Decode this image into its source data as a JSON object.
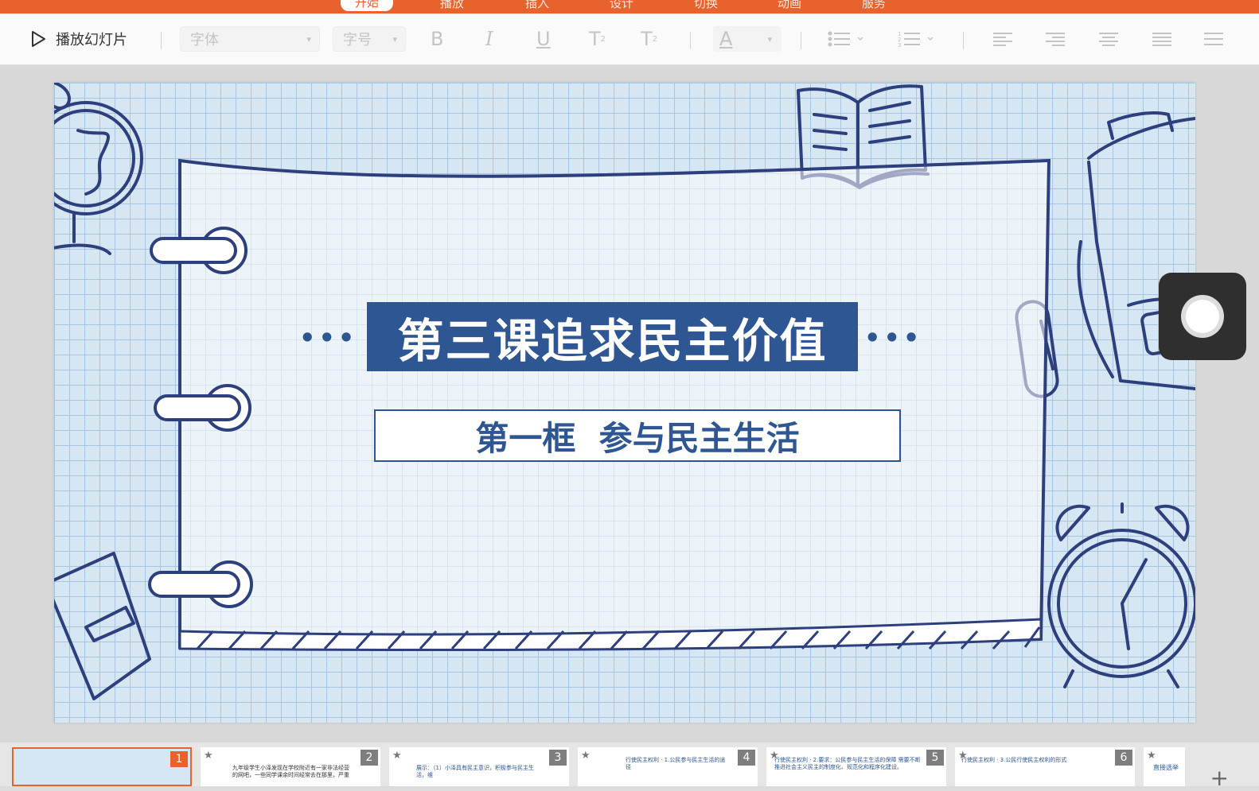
{
  "tabs": {
    "items": [
      "开始",
      "播放",
      "插入",
      "设计",
      "切换",
      "动画",
      "服务"
    ]
  },
  "toolbar": {
    "play_label": "播放幻灯片",
    "font_placeholder": "字体",
    "size_placeholder": "字号",
    "bold": "B",
    "italic": "I",
    "underline": "U",
    "superscript": "T",
    "subscript": "T",
    "font_color": "A"
  },
  "slide": {
    "title": "第三课追求民主价值",
    "subtitle": "第一框  参与民主生活",
    "left_dots": "•••",
    "right_dots": "•••"
  },
  "thumbnails": {
    "items": [
      {
        "num": "1",
        "text": ""
      },
      {
        "num": "2",
        "text": "九年级学生小泽发现在学校附近有一家非法经营的网吧，一些同学课余时间经常去在那里，严重"
      },
      {
        "num": "3",
        "text": "展示：（1）小泽具有民主意识，积极参与民主生活，维"
      },
      {
        "num": "4",
        "text": "行使民主权利 · 1.公民参与民主生活的途径"
      },
      {
        "num": "5",
        "text": "行使民主权利 · 2.要求：公民参与民主生活的保障 需要不断推进社会主义民主的制度化、规范化和程序化建设。"
      },
      {
        "num": "6",
        "text": "行使民主权利 · 3.公民行使民主权利的形式"
      },
      {
        "num": "",
        "text": "直接选举"
      }
    ]
  },
  "colors": {
    "accent": "#e8622e",
    "slide_blue": "#2d5693",
    "grid_bg": "#d6e6f3"
  }
}
